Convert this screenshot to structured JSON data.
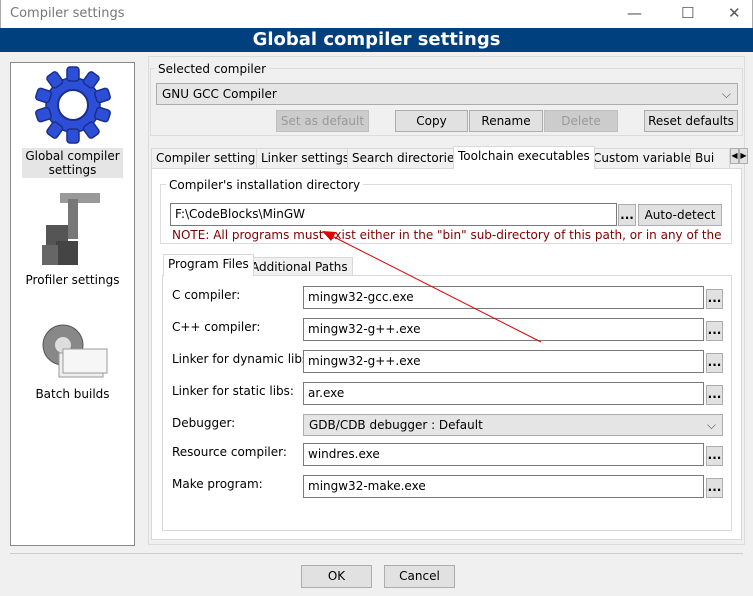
{
  "window": {
    "title": "Compiler settings",
    "minimize": "—",
    "maximize": "☐",
    "close": "✕"
  },
  "banner": "Global compiler settings",
  "sidebar": {
    "items": [
      {
        "label1": "Global compiler",
        "label2": "settings",
        "icon": "gear-icon",
        "selected": true
      },
      {
        "label": "Profiler settings",
        "icon": "profiler-icon"
      },
      {
        "label": "Batch builds",
        "icon": "batch-builds-icon"
      }
    ]
  },
  "selected_compiler": {
    "label": "Selected compiler",
    "value": "GNU GCC Compiler"
  },
  "compiler_buttons": {
    "set_default": "Set as default",
    "copy": "Copy",
    "rename": "Rename",
    "delete": "Delete",
    "reset": "Reset defaults"
  },
  "tabs": [
    "Compiler settings",
    "Linker settings",
    "Search directories",
    "Toolchain executables",
    "Custom variables",
    "Bui"
  ],
  "active_tab": "Toolchain executables",
  "install_dir": {
    "label": "Compiler's installation directory",
    "value": "F:\\CodeBlocks\\MinGW",
    "browse": "...",
    "autodetect": "Auto-detect",
    "note": "NOTE: All programs must exist either in the \"bin\" sub-directory of this path, or in any of the"
  },
  "subtabs": [
    "Program Files",
    "Additional Paths"
  ],
  "programs": [
    {
      "label": "C compiler:",
      "value": "mingw32-gcc.exe"
    },
    {
      "label": "C++ compiler:",
      "value": "mingw32-g++.exe"
    },
    {
      "label": "Linker for dynamic libs:",
      "value": "mingw32-g++.exe"
    },
    {
      "label": "Linker for static libs:",
      "value": "ar.exe"
    },
    {
      "label": "Debugger:",
      "value": "GDB/CDB debugger : Default",
      "type": "dropdown"
    },
    {
      "label": "Resource compiler:",
      "value": "windres.exe"
    },
    {
      "label": "Make program:",
      "value": "mingw32-make.exe"
    }
  ],
  "browse": "...",
  "footer": {
    "ok": "OK",
    "cancel": "Cancel"
  },
  "colors": {
    "banner": "#00407f",
    "note": "#800000",
    "annotation_arrow": "#e00000"
  }
}
